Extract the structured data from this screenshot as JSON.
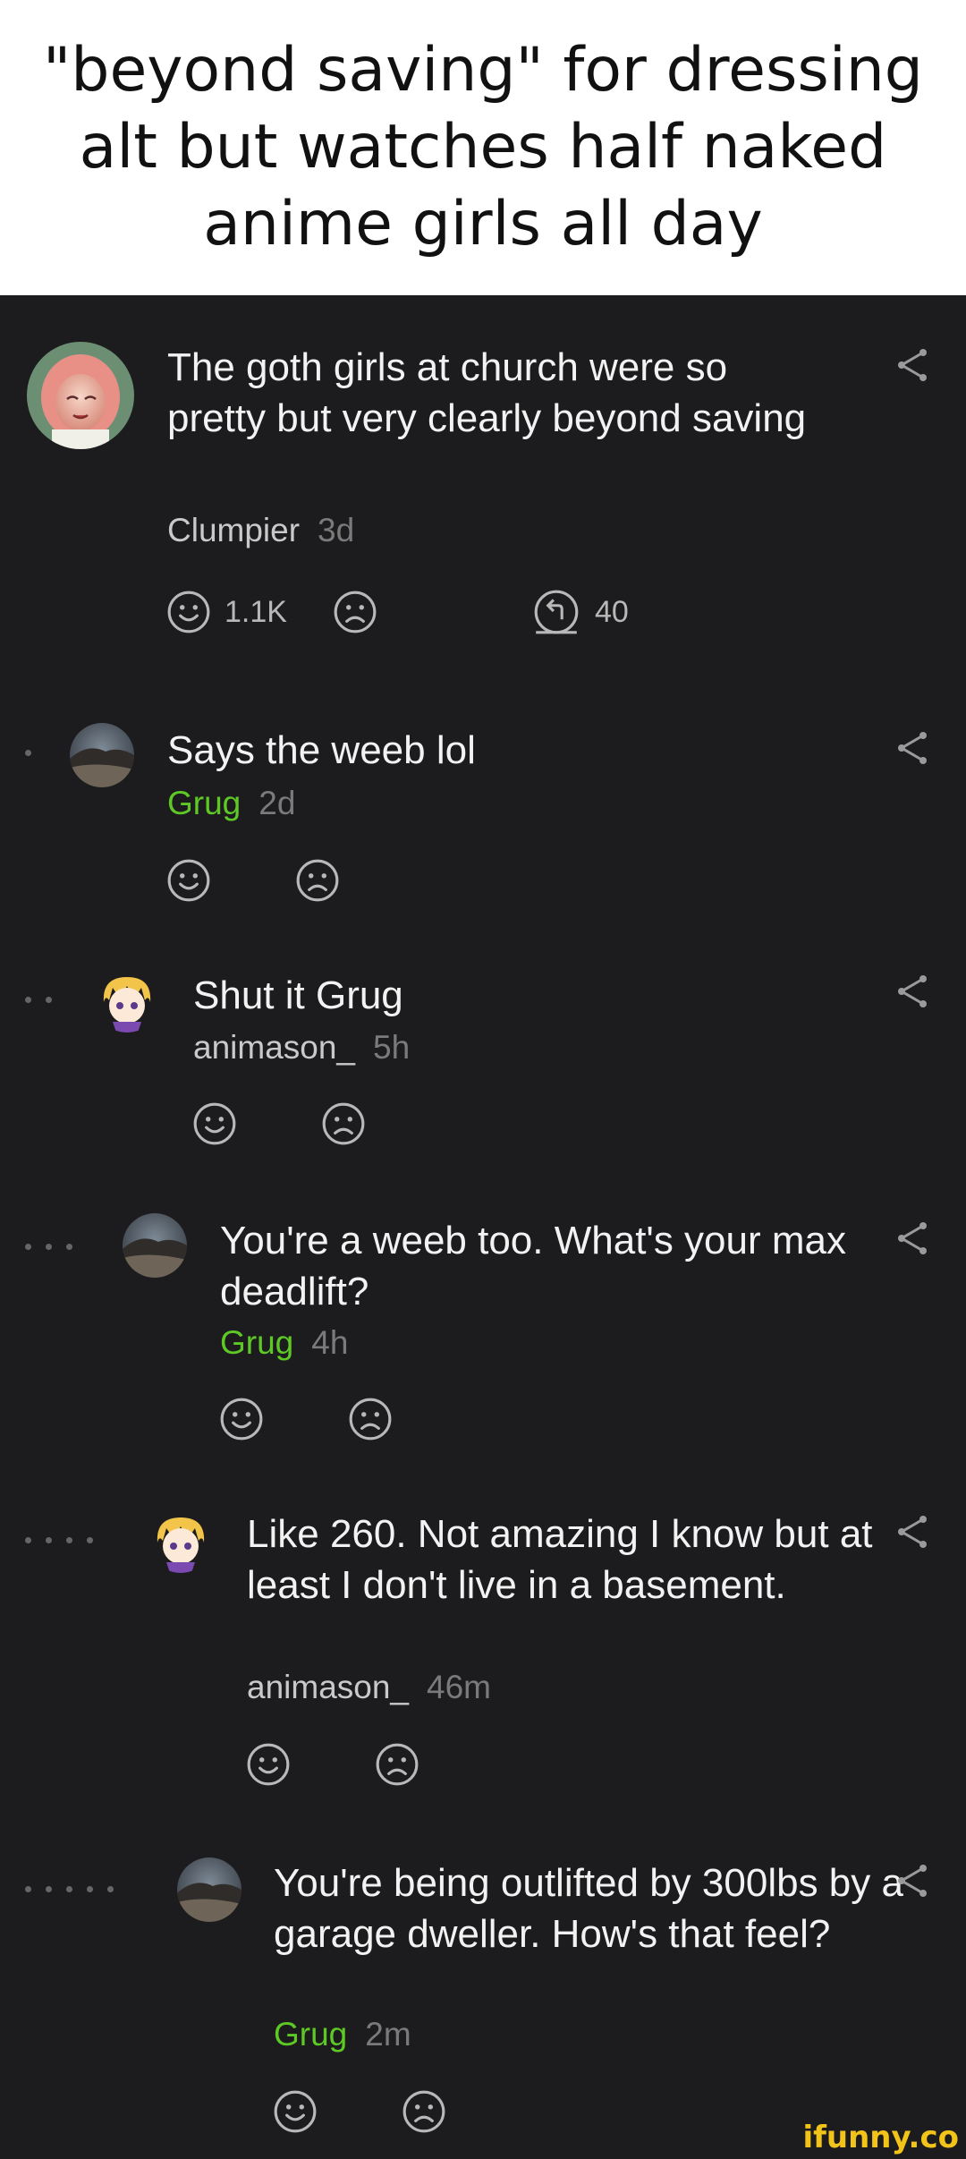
{
  "title": "\"beyond saving\" for dressing alt but watches half naked anime girls all day",
  "comments": [
    {
      "text": "The goth girls at church were so pretty but very clearly beyond saving",
      "author": "Clumpier",
      "time": "3d",
      "likes": "1.1K",
      "replies": "40"
    },
    {
      "text": "Says the weeb lol",
      "author": "Grug",
      "time": "2d"
    },
    {
      "text": "Shut it Grug",
      "author": "animason_",
      "time": "5h"
    },
    {
      "text": "You're a weeb too. What's your max deadlift?",
      "author": "Grug",
      "time": "4h"
    },
    {
      "text": "Like 260. Not amazing I know but at least I don't live in a basement.",
      "author": "animason_",
      "time": "46m"
    },
    {
      "text": "You're being outlifted by 300lbs by a garage dweller. How's that feel?",
      "author": "Grug",
      "time": "2m"
    }
  ],
  "colors": {
    "background": "#1c1c1e",
    "username_green": "#5ec926",
    "watermark": "#f2c318"
  },
  "watermark": "ifunny.co"
}
